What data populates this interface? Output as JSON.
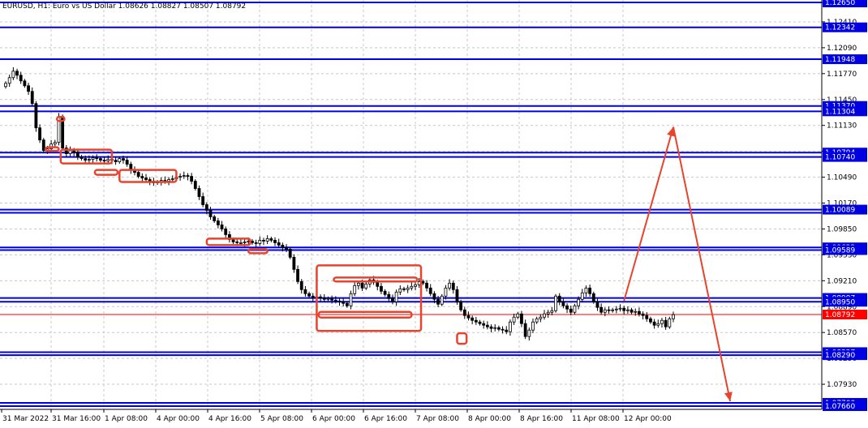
{
  "header": {
    "text": "EURUSD, H1:  Euro vs US Dollar  1.08626 1.08827 1.08507 1.08792"
  },
  "chart_data": {
    "type": "candlestick",
    "symbol": "EURUSD",
    "timeframe": "H1",
    "description": "Euro vs US Dollar",
    "ohlc_last": {
      "open": 1.08626,
      "high": 1.08827,
      "low": 1.08507,
      "close": 1.08792
    },
    "ylim": [
      1.0762,
      1.1268
    ],
    "y_ticks": [
      "1.12650",
      "1.12410",
      "1.12090",
      "1.11770",
      "1.11450",
      "1.11130",
      "1.10810",
      "1.10490",
      "1.10170",
      "1.09850",
      "1.09530",
      "1.09210",
      "1.08890",
      "1.08570",
      "1.08250",
      "1.07930"
    ],
    "x_labels": [
      "31 Mar 2022",
      "31 Mar 16:00",
      "1 Apr 08:00",
      "4 Apr 00:00",
      "4 Apr 16:00",
      "5 Apr 08:00",
      "6 Apr 00:00",
      "6 Apr 16:00",
      "7 Apr 08:00",
      "8 Apr 00:00",
      "8 Apr 16:00",
      "11 Apr 08:00",
      "12 Apr 00:00"
    ],
    "current_price": "1.08792",
    "current_price_color": "#ff0000",
    "levels": [
      {
        "value": 1.1265,
        "label": "1.12650"
      },
      {
        "value": 1.12342,
        "label": "1.12342"
      },
      {
        "value": 1.11948,
        "label": "1.11948"
      },
      {
        "value": 1.1137,
        "label": "1.11370"
      },
      {
        "value": 1.11304,
        "label": "1.11304"
      },
      {
        "value": 1.10794,
        "label": "1.10794"
      },
      {
        "value": 1.1074,
        "label": "1.10740"
      },
      {
        "value": 1.10089,
        "label": "1.10089"
      },
      {
        "value": 1.1005,
        "label": ""
      },
      {
        "value": 1.09622,
        "label": "1.09622"
      },
      {
        "value": 1.09589,
        "label": "1.09589"
      },
      {
        "value": 1.08997,
        "label": "1.08997"
      },
      {
        "value": 1.0895,
        "label": "1.08950"
      },
      {
        "value": 1.08327,
        "label": "1.08327"
      },
      {
        "value": 1.0829,
        "label": "1.08290"
      },
      {
        "value": 1.077,
        "label": "1.07700"
      },
      {
        "value": 1.0766,
        "label": "1.07660"
      }
    ],
    "close_series": [
      1.1165,
      1.1172,
      1.118,
      1.1175,
      1.1168,
      1.1162,
      1.1155,
      1.114,
      1.111,
      1.1095,
      1.1082,
      1.1084,
      1.109,
      1.1092,
      1.1124,
      1.1085,
      1.1078,
      1.1082,
      1.108,
      1.1074,
      1.1072,
      1.107,
      1.1071,
      1.1073,
      1.1072,
      1.107,
      1.1069,
      1.1071,
      1.107,
      1.1068,
      1.1072,
      1.107,
      1.1065,
      1.1058,
      1.1055,
      1.105,
      1.1048,
      1.1046,
      1.1044,
      1.1042,
      1.1043,
      1.1045,
      1.1044,
      1.1046,
      1.1047,
      1.1049,
      1.105,
      1.1051,
      1.105,
      1.1044,
      1.1035,
      1.1025,
      1.1015,
      1.1008,
      1.1,
      1.0995,
      1.099,
      1.0985,
      1.0978,
      1.0972,
      1.0969,
      1.0968,
      1.0968,
      1.0969,
      1.097,
      1.0968,
      1.0967,
      1.0971,
      1.097,
      1.0973,
      1.0971,
      1.0968,
      1.0965,
      1.0962,
      1.096,
      1.095,
      1.0935,
      1.092,
      1.091,
      1.0905,
      1.0902,
      1.09,
      1.0901,
      1.09,
      1.0898,
      1.0899,
      1.0897,
      1.0896,
      1.0895,
      1.0893,
      1.089,
      1.0905,
      1.0915,
      1.0918,
      1.0912,
      1.0917,
      1.0922,
      1.0919,
      1.0914,
      1.0908,
      1.0904,
      1.0899,
      1.0895,
      1.0907,
      1.0911,
      1.091,
      1.0912,
      1.0914,
      1.0916,
      1.092,
      1.0918,
      1.0912,
      1.0905,
      1.0898,
      1.0892,
      1.0902,
      1.0912,
      1.0918,
      1.091,
      1.0895,
      1.0885,
      1.0878,
      1.0875,
      1.0872,
      1.087,
      1.0868,
      1.0866,
      1.0864,
      1.0862,
      1.0863,
      1.0861,
      1.086,
      1.0858,
      1.087,
      1.0876,
      1.088,
      1.0868,
      1.0852,
      1.086,
      1.087,
      1.0874,
      1.0876,
      1.088,
      1.0882,
      1.0884,
      1.0902,
      1.0895,
      1.089,
      1.0886,
      1.0882,
      1.089,
      1.0898,
      1.0906,
      1.0912,
      1.0905,
      1.0895,
      1.0888,
      1.0882,
      1.0885,
      1.0884,
      1.0885,
      1.0886,
      1.0887,
      1.0884,
      1.0885,
      1.0882,
      1.0883,
      1.088,
      1.0878,
      1.0874,
      1.087,
      1.0866,
      1.0868,
      1.0872,
      1.0864,
      1.0874,
      1.0879
    ],
    "annotations": {
      "boxes_color": "#e8432c",
      "arrows": [
        {
          "from": [
            163,
            1.0896
          ],
          "to": [
            176,
            1.1111
          ]
        },
        {
          "from": [
            176,
            1.1111
          ],
          "to": [
            191,
            1.0772
          ]
        }
      ],
      "boxes": [
        {
          "x1": 13.5,
          "x2": 15.5,
          "y1": 1.11235,
          "y2": 1.11185
        },
        {
          "x1": 10.5,
          "x2": 14.0,
          "y1": 1.1086,
          "y2": 1.10815
        },
        {
          "x1": 14.5,
          "x2": 28.0,
          "y1": 1.1083,
          "y2": 1.1066
        },
        {
          "x1": 23.5,
          "x2": 29.5,
          "y1": 1.1058,
          "y2": 1.1052
        },
        {
          "x1": 30.0,
          "x2": 45.0,
          "y1": 1.1058,
          "y2": 1.1043
        },
        {
          "x1": 53.0,
          "x2": 64.5,
          "y1": 1.0973,
          "y2": 1.0965
        },
        {
          "x1": 64.0,
          "x2": 69.0,
          "y1": 1.096,
          "y2": 1.0955
        },
        {
          "x1": 82.0,
          "x2": 109.5,
          "y1": 1.094,
          "y2": 1.0859
        },
        {
          "x1": 86.5,
          "x2": 108.5,
          "y1": 1.0925,
          "y2": 1.092
        },
        {
          "x1": 82.5,
          "x2": 107.0,
          "y1": 1.08825,
          "y2": 1.08755
        },
        {
          "x1": 119.0,
          "x2": 121.5,
          "y1": 1.0856,
          "y2": 1.0843
        }
      ]
    }
  }
}
